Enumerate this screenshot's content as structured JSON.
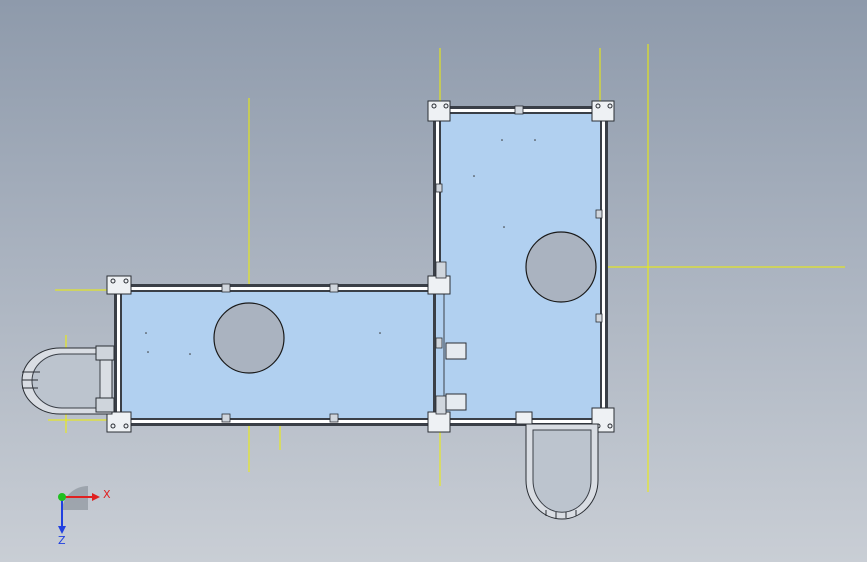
{
  "viewport": {
    "background_top": "#8e9aab",
    "background_bottom": "#c9ced5"
  },
  "model": {
    "plate_fill": "#b1d0f0",
    "frame_color": "#3a3f47",
    "frame_inner": "#ffffff",
    "guide_color": "#f0f000",
    "cutout_fill": "#aab3c0"
  },
  "triad": {
    "x_label": "X",
    "z_label": "Z",
    "x_color": "#e02020",
    "y_color": "#20c020",
    "z_color": "#2040e0"
  }
}
